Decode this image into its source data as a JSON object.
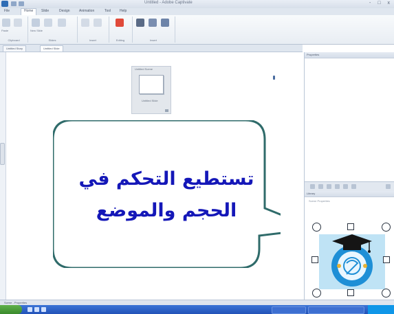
{
  "window": {
    "title": "Untitled - Adobe Captivate",
    "controls": "- □ x"
  },
  "ribbon": {
    "tabs": [
      "File",
      "Home",
      "Slide",
      "Design",
      "Animation",
      "Tool",
      "Help"
    ],
    "active_tab": "Home",
    "groups": [
      "Clipboard",
      "Slides",
      "Insert",
      "Editing",
      "Insert"
    ],
    "items": [
      "Paste",
      "Cut",
      "Copy",
      "New Slide",
      "Duplicate",
      "Delete",
      "Text",
      "Shape",
      "Caption",
      "Record",
      "Image",
      "Preview",
      "Publish"
    ]
  },
  "doc_tabs": [
    "Untitled Story",
    "Untitled Slide"
  ],
  "canvas": {
    "thumb_title": "Untitled Scene",
    "thumb_subtitle": "Untitled Slide"
  },
  "panes": {
    "top_title": "Properties",
    "bottom_title": "Library",
    "bottom_sub": "Scene Properties"
  },
  "callout": {
    "line1": "تستطيع التحكم في",
    "line2": "الحجم والموضع",
    "fill": "#ffffff",
    "border_color": "#2f6b6a",
    "text_color": "#1417b8"
  },
  "status": {
    "left_text": "Scene - Properties"
  },
  "icons": [
    "application-icon",
    "graduation-cap-icon",
    "globe-logo-icon"
  ]
}
